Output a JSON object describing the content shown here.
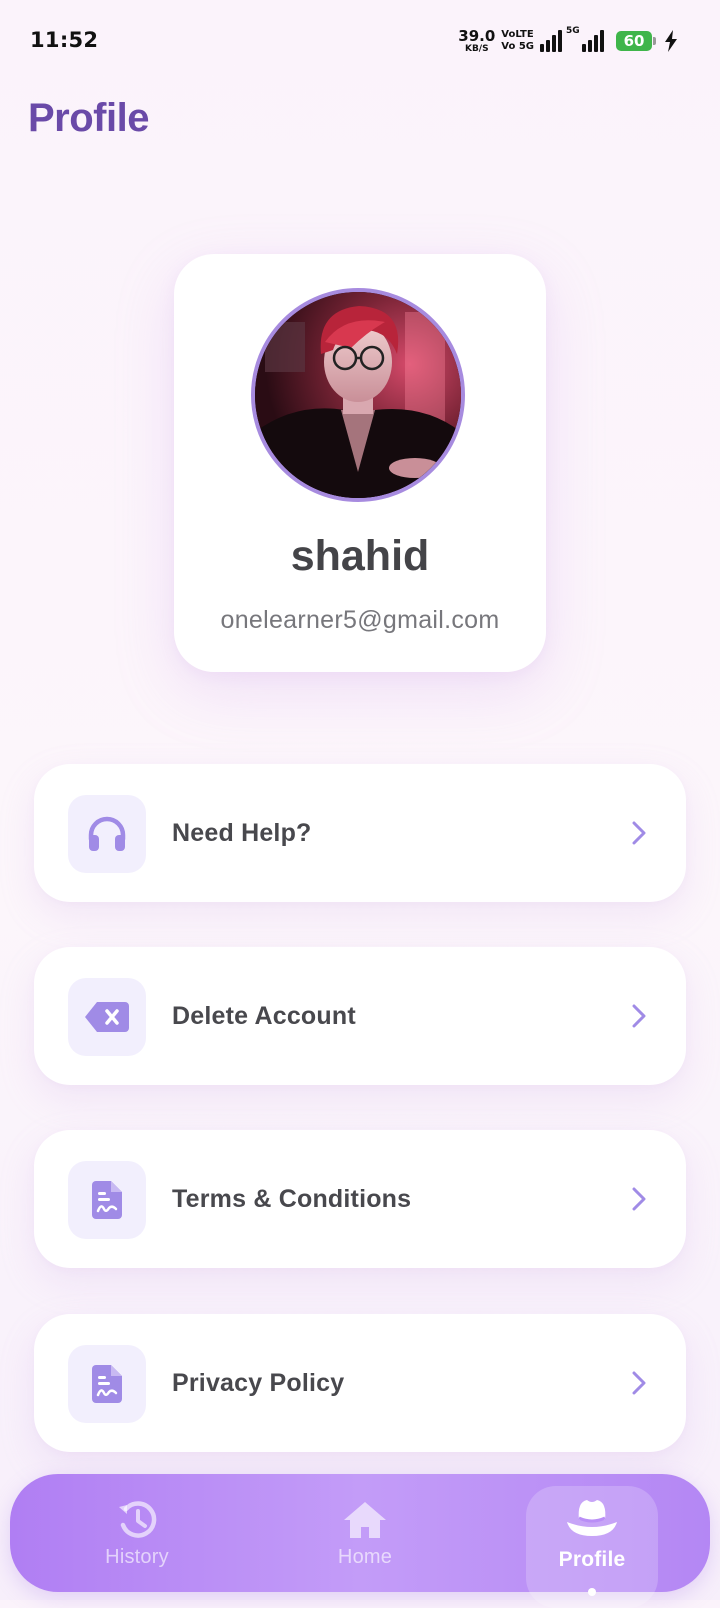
{
  "status_bar": {
    "time": "11:52",
    "net_speed_value": "39.0",
    "net_speed_unit": "KB/S",
    "volte_top": "VoLTE",
    "volte_bottom": "Vo 5G",
    "network_tag": "5G",
    "battery_level": "60"
  },
  "header": {
    "title": "Profile"
  },
  "profile": {
    "name": "shahid",
    "email": "onelearner5@gmail.com",
    "avatar_icon": "avatar-portrait"
  },
  "menu": {
    "items": [
      {
        "label": "Need Help?",
        "icon": "headset-icon"
      },
      {
        "label": "Delete Account",
        "icon": "backspace-icon"
      },
      {
        "label": "Terms & Conditions",
        "icon": "document-icon"
      },
      {
        "label": "Privacy Policy",
        "icon": "document-icon"
      }
    ]
  },
  "nav": {
    "tabs": [
      {
        "label": "History",
        "icon": "history-icon"
      },
      {
        "label": "Home",
        "icon": "home-icon"
      },
      {
        "label": "Profile",
        "icon": "hat-icon",
        "active": true
      }
    ]
  },
  "colors": {
    "accent": "#6a4aa8",
    "icon_purple": "#a08be6",
    "nav_gradient_start": "#b07ef3",
    "nav_gradient_end": "#c39cf8",
    "battery_green": "#3fb54a"
  }
}
